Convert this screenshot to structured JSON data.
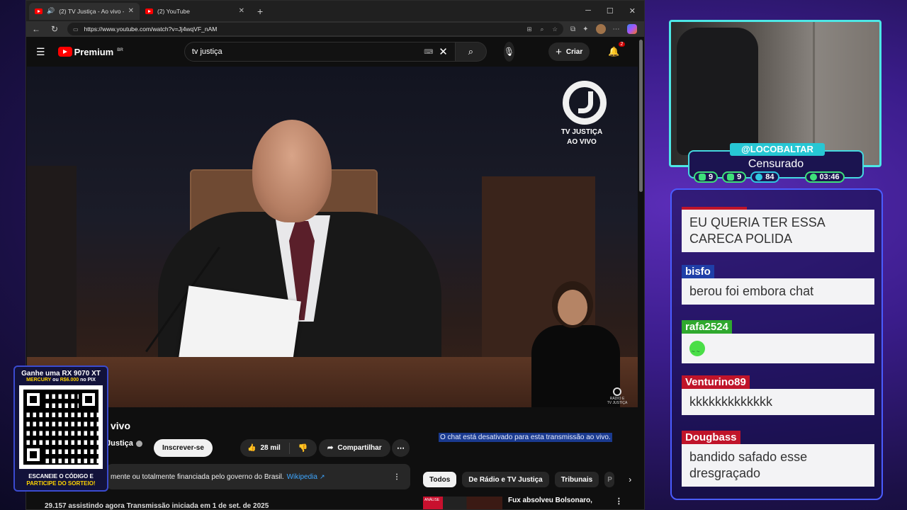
{
  "browser": {
    "tabs": [
      {
        "title": "(2) TV Justiça - Ao vivo - You",
        "active": true
      },
      {
        "title": "(2) YouTube",
        "active": false
      }
    ],
    "url": "https://www.youtube.com/watch?v=Jj4wqVF_nAM"
  },
  "youtube": {
    "logo_text": "Premium",
    "logo_region": "BR",
    "search_value": "tv justiça",
    "create_label": "Criar",
    "notification_count": "2",
    "video_overlay": {
      "logo_line1": "TV JUSTIÇA",
      "logo_line2": "AO VIVO",
      "corner_logo_line1": "RÁDIO E",
      "corner_logo_line2": "TV JUSTIÇA"
    },
    "video_title_visible": "vivo",
    "channel_name_visible": "Justiça",
    "subscribe_label": "Inscrever-se",
    "likes": "28 mil",
    "share_label": "Compartilhar",
    "info_banner_text": "mente ou totalmente financiada pelo governo do Brasil.",
    "info_banner_link": "Wikipedia",
    "views_line": "29.157 assistindo agora  Transmissão iniciada em 1 de set. de 2025",
    "chat_disabled": "O chat está desativado para esta transmissão ao vivo.",
    "chips": [
      "Todos",
      "De Rádio e TV Justiça",
      "Tribunais",
      "P"
    ],
    "rec_badge": "ANÁLISE",
    "rec_title": "Fux absolveu Bolsonaro,"
  },
  "promo": {
    "line1": "Ganhe uma RX 9070 XT",
    "line2_a": "MERCURY",
    "line2_b": " ou ",
    "line2_c": "R$6.000",
    "line2_d": " no PIX",
    "line3": "ESCANEIE O CÓDIGO E",
    "line4": "PARTICIPE DO SORTEIO!"
  },
  "stream": {
    "handle": "@LOCOBALTAR",
    "status": "Censurado",
    "stats": {
      "twitch": "9",
      "youtube": "9",
      "kick": "84",
      "timer": "03:46"
    }
  },
  "chat": [
    {
      "user": "",
      "text": "EU QUERIA TER ESSA CARECA POLIDA",
      "color": "#c0142a"
    },
    {
      "user": "bisfo",
      "text": "berou foi embora chat",
      "color": "#1f3fa8"
    },
    {
      "user": "rafa2524",
      "text": "",
      "emoji": "green-face-emote",
      "color": "#2fa82e"
    },
    {
      "user": "Venturino89",
      "text": "kkkkkkkkkkkkk",
      "color": "#c0142a"
    },
    {
      "user": "Dougbass",
      "text": "bandido safado esse dresgraçado",
      "color": "#c0142a"
    }
  ]
}
